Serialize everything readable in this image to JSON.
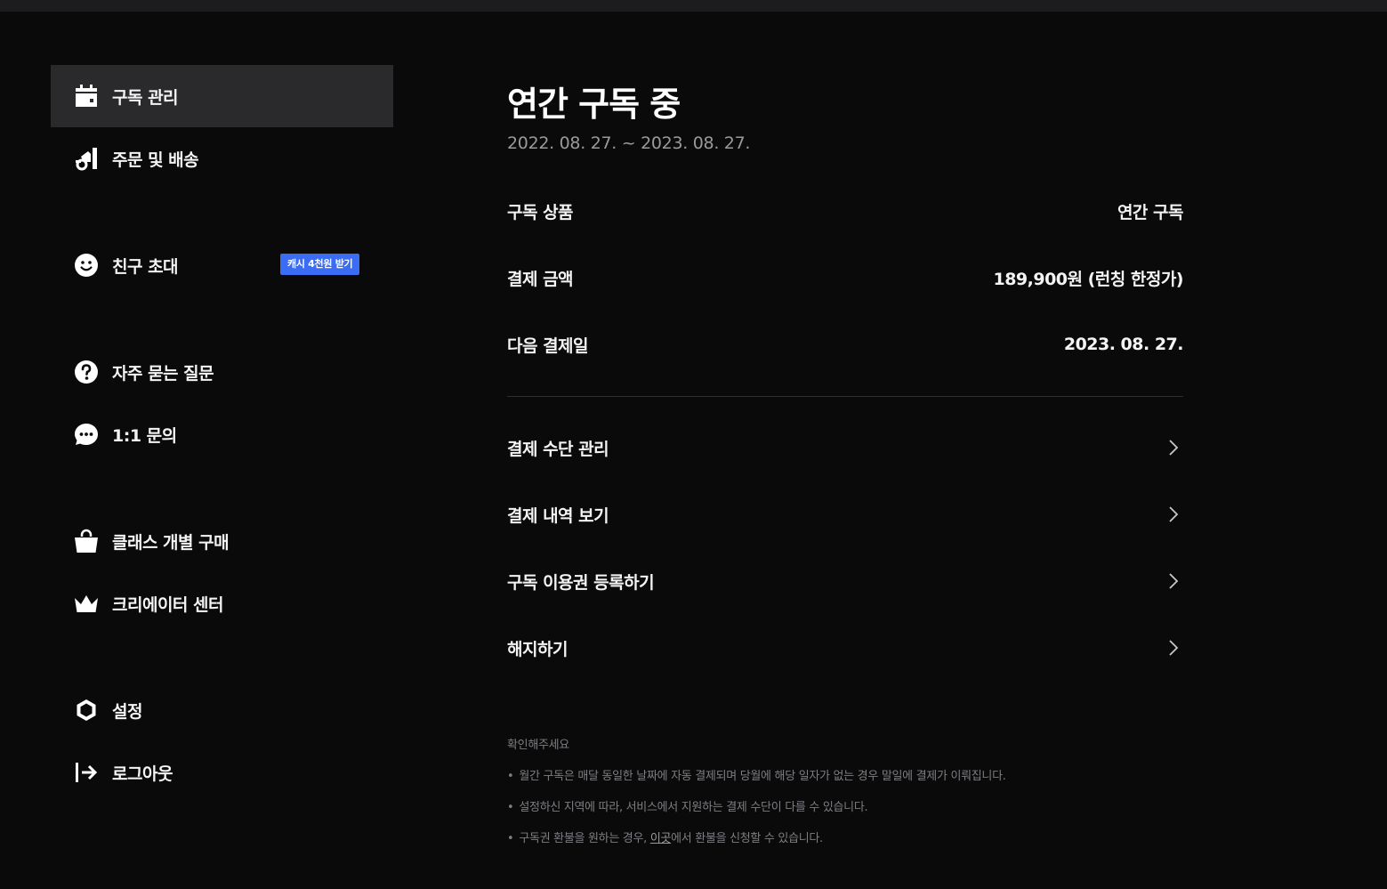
{
  "sidebar": {
    "items": [
      {
        "label": "구독 관리",
        "icon": "calendar-icon",
        "active": true
      },
      {
        "label": "주문 및 배송",
        "icon": "delivery-icon"
      },
      {
        "label": "친구 초대",
        "icon": "smile-icon",
        "badge": "캐시 4천원 받기"
      },
      {
        "label": "자주 묻는 질문",
        "icon": "question-icon"
      },
      {
        "label": "1:1 문의",
        "icon": "chat-icon"
      },
      {
        "label": "클래스 개별 구매",
        "icon": "shopping-bag-icon"
      },
      {
        "label": "크리에이터 센터",
        "icon": "crown-icon"
      },
      {
        "label": "설정",
        "icon": "settings-icon"
      },
      {
        "label": "로그아웃",
        "icon": "logout-icon"
      }
    ]
  },
  "main": {
    "title": "연간 구독 중",
    "period": "2022. 08. 27. ~ 2023. 08. 27.",
    "info": [
      {
        "label": "구독 상품",
        "value": "연간 구독"
      },
      {
        "label": "결제 금액",
        "value": "189,900원 (런칭 한정가)"
      },
      {
        "label": "다음 결제일",
        "value": "2023. 08. 27."
      }
    ],
    "actions": [
      {
        "label": "결제 수단 관리"
      },
      {
        "label": "결제 내역 보기"
      },
      {
        "label": "구독 이용권 등록하기"
      },
      {
        "label": "해지하기"
      }
    ],
    "notice": {
      "title": "확인해주세요",
      "bullet": "•",
      "lines": [
        "월간 구독은 매달 동일한 날짜에 자동 결제되며 당월에 해당 일자가 없는 경우 말일에 결제가 이뤄집니다.",
        "설정하신 지역에 따라, 서비스에서 지원하는 결제 수단이 다를 수 있습니다."
      ],
      "refund_prefix": "구독권 환불을 원하는 경우, ",
      "refund_link": "이곳",
      "refund_suffix": "에서 환불을 신청할 수 있습니다."
    }
  },
  "colors": {
    "background": "#0a0a0b",
    "active_item": "#2a2a2c",
    "badge": "#3a6cf4",
    "muted_text": "#9a9a9e"
  }
}
